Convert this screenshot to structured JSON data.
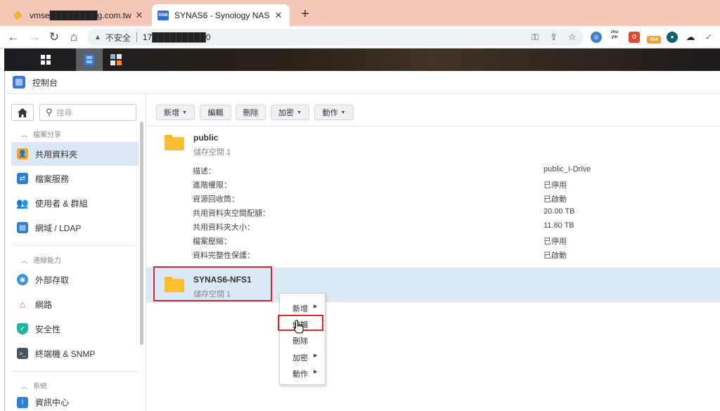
{
  "browser": {
    "tabs": [
      {
        "title": "vmse████████g.com.tw - VM"
      },
      {
        "favicon": "DSM",
        "title": "SYNAS6 - Synology NAS"
      }
    ],
    "new_tab": "+",
    "address": {
      "security": "不安全",
      "url": "17█████████0"
    },
    "extensions": [
      {
        "name": "zhuyin-ext",
        "label": "zhu\nyin"
      },
      {
        "name": "badge-ext",
        "label": "454"
      }
    ]
  },
  "window": {
    "title": "控制台"
  },
  "sidebar": {
    "search_placeholder": "搜尋",
    "groups": [
      {
        "label": "檔案分享"
      },
      {
        "label": "連線能力"
      },
      {
        "label": "系統"
      }
    ],
    "items": [
      {
        "label": "共用資料夾",
        "icon": "shared-folder-icon",
        "color": "#f5a623"
      },
      {
        "label": "檔案服務",
        "icon": "file-service-icon",
        "color": "#2f7fd9"
      },
      {
        "label": "使用者 & 群組",
        "icon": "user-group-icon",
        "color": "#2f8fe0"
      },
      {
        "label": "網域 / LDAP",
        "icon": "domain-icon",
        "color": "#2f7fd9"
      },
      {
        "label": "外部存取",
        "icon": "external-access-icon",
        "color": "#2f8fe0"
      },
      {
        "label": "網路",
        "icon": "network-icon",
        "color": "#e05a3a"
      },
      {
        "label": "安全性",
        "icon": "security-icon",
        "color": "#1fb5a0"
      },
      {
        "label": "終端機 & SNMP",
        "icon": "terminal-icon",
        "color": "#445566"
      },
      {
        "label": "資訊中心",
        "icon": "info-center-icon",
        "color": "#2f7fd9"
      }
    ]
  },
  "toolbar": {
    "create": "新增",
    "edit": "編輯",
    "delete": "刪除",
    "encrypt": "加密",
    "action": "動作"
  },
  "folders": [
    {
      "name": "public",
      "volume": "儲存空間 1",
      "properties": [
        {
          "label": "描述：",
          "value": "public_I-Drive"
        },
        {
          "label": "進階權限：",
          "value": "已停用"
        },
        {
          "label": "資源回收筒：",
          "value": "已啟動"
        },
        {
          "label": "共用資料夾空間配額：",
          "value": "20.00 TB"
        },
        {
          "label": "共用資料夾大小：",
          "value": "11.80 TB"
        },
        {
          "label": "檔案壓縮：",
          "value": "已停用"
        },
        {
          "label": "資料完整性保護：",
          "value": "已啟動"
        }
      ]
    },
    {
      "name": "SYNAS6-NFS1",
      "volume": "儲存空間 1"
    }
  ],
  "context_menu": {
    "create": "新增",
    "edit": "編輯",
    "delete": "刪除",
    "encrypt": "加密",
    "action": "動作"
  },
  "colors": {
    "accent": "#2d6fd6",
    "selection": "#dbe9f6",
    "highlight": "#d9262c",
    "folder": "#fbbf2f"
  }
}
